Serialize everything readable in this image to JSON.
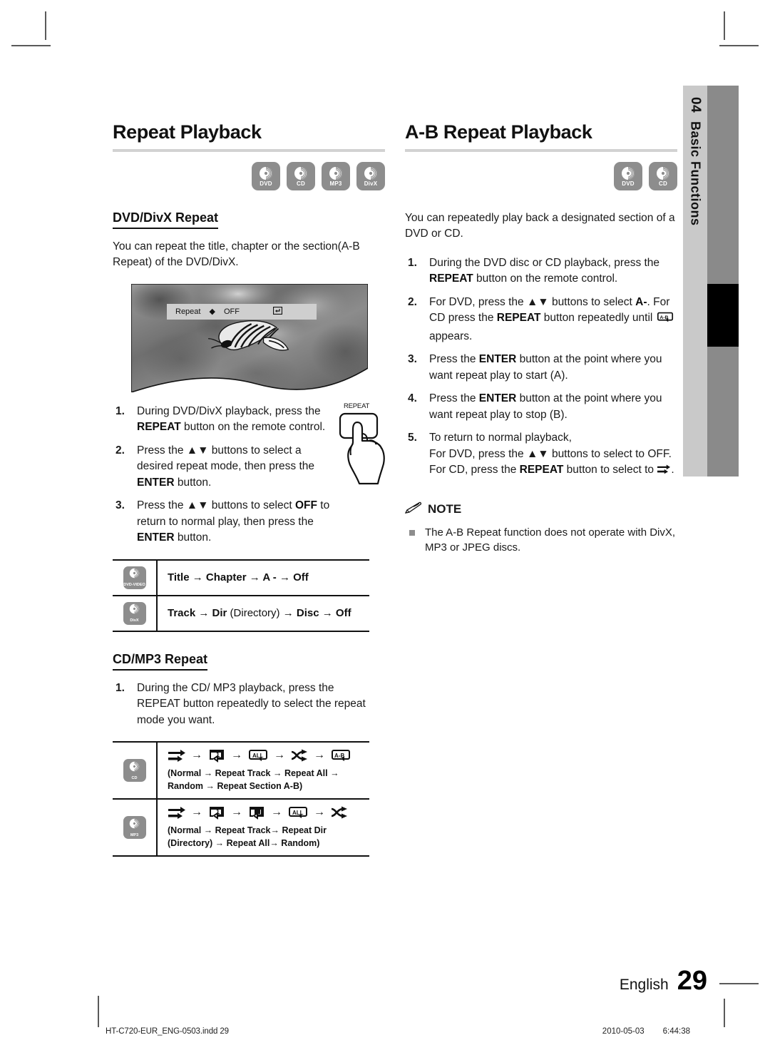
{
  "document": {
    "chapter_number": "04",
    "chapter_name": "Basic Functions",
    "page_language": "English",
    "page_number": "29",
    "footer_filename": "HT-C720-EUR_ENG-0503.indd   29",
    "footer_date": "2010-05-03",
    "footer_time": "6:44:38"
  },
  "left_column": {
    "title": "Repeat Playback",
    "badges": [
      {
        "label": "DVD",
        "name": "dvd-badge"
      },
      {
        "label": "CD",
        "name": "cd-badge"
      },
      {
        "label": "MP3",
        "name": "mp3-badge"
      },
      {
        "label": "DivX",
        "name": "divx-badge"
      }
    ],
    "subsection_1": {
      "heading": "DVD/DivX Repeat",
      "intro": "You can repeat the title, chapter or the section(A-B Repeat) of the DVD/DivX.",
      "figure": {
        "osd_label": "Repeat",
        "osd_value": "OFF",
        "osd_updown_icon": "up-down-arrows-icon",
        "osd_return_icon": "return-icon"
      },
      "remote_label": "REPEAT",
      "steps": [
        {
          "num": "1.",
          "html": "During DVD/DivX playback, press the <b>REPEAT</b> button on the remote control."
        },
        {
          "num": "2.",
          "html": "Press the ▲▼ buttons to select a desired repeat mode, then press the <b>ENTER</b> button."
        },
        {
          "num": "3.",
          "html": "Press the ▲▼ buttons to select <b>OFF</b> to return to normal play, then press the <b>ENTER</b> button."
        }
      ],
      "mode_table": [
        {
          "icon_label": "DVD-VIDEO",
          "text_html": "Title → Chapter → A - → Off"
        },
        {
          "icon_label": "DivX",
          "text_html": "Track → Dir <span class=\"norm\">(Directory)</span> → Disc → Off"
        }
      ]
    },
    "subsection_2": {
      "heading": "CD/MP3 Repeat",
      "steps": [
        {
          "num": "1.",
          "html": "During the CD/ MP3 playback, press the REPEAT button repeatedly to select the repeat mode you want."
        }
      ],
      "mode_table": [
        {
          "icon_label": "CD",
          "icons": [
            "normal-arrows-icon",
            "repeat-track-icon",
            "repeat-all-icon",
            "shuffle-icon",
            "repeat-ab-icon"
          ],
          "caption": "(Normal → Repeat Track → Repeat All → Random → Repeat Section A-B)"
        },
        {
          "icon_label": "MP3",
          "icons": [
            "normal-arrows-icon",
            "repeat-track-icon",
            "repeat-dir-icon",
            "repeat-all-icon",
            "shuffle-icon"
          ],
          "caption": "(Normal  → Repeat Track→ Repeat Dir (Directory) → Repeat All→ Random)"
        }
      ]
    }
  },
  "right_column": {
    "title": "A-B Repeat Playback",
    "badges": [
      {
        "label": "DVD",
        "name": "dvd-badge"
      },
      {
        "label": "CD",
        "name": "cd-badge"
      }
    ],
    "intro": "You can repeatedly play back a designated section of a DVD or CD.",
    "steps": [
      {
        "num": "1.",
        "html": "During the DVD disc or CD playback, press the <b>REPEAT</b> button on the remote control."
      },
      {
        "num": "2.",
        "html": "For DVD, press the ▲▼ buttons to select <b>A-</b>. For CD press the <b>REPEAT</b> button repeatedly until <span class=\"ab-slot\"></span> appears."
      },
      {
        "num": "3.",
        "html": "Press the <b>ENTER</b> button at the point where you want repeat play to start (A)."
      },
      {
        "num": "4.",
        "html": "Press the <b>ENTER</b> button at the point where you want repeat play to stop (B)."
      },
      {
        "num": "5.",
        "html": "To return to normal playback,<br>For DVD, press the ▲▼ buttons to select to OFF.<br>For CD, press the <b>REPEAT</b> button to select to <span class=\"arr-slot\"></span>."
      }
    ],
    "note": {
      "heading": "NOTE",
      "icon": "pencil-icon",
      "items": [
        "The A-B Repeat function does not operate with DivX, MP3 or JPEG discs."
      ]
    }
  }
}
